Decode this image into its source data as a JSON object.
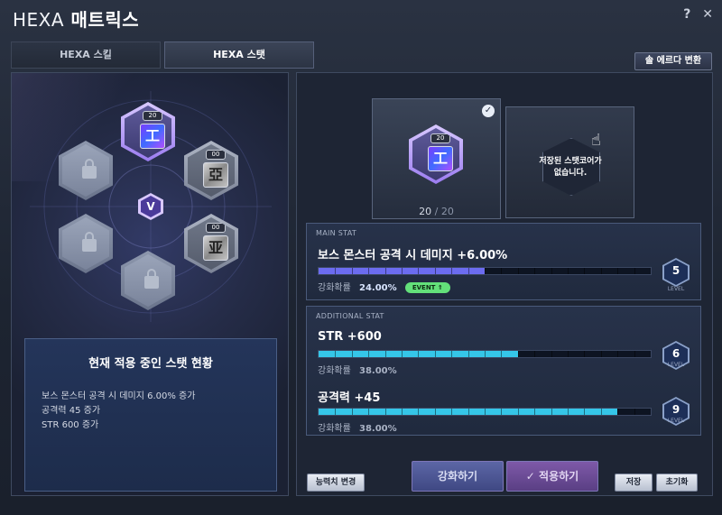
{
  "window": {
    "title_prefix": "HEXA",
    "title_main": "매트릭스",
    "help_icon": "?",
    "close_icon": "✕"
  },
  "tabs": [
    {
      "label": "HEXA 스킬"
    },
    {
      "label": "HEXA 스탯"
    }
  ],
  "sol_erda_button": "솔 에르다 변환",
  "matrix": {
    "top_core": {
      "level": "20",
      "glyph": "工"
    },
    "right_top_core": {
      "level": "00",
      "glyph": "亞"
    },
    "right_bottom_core": {
      "level": "00",
      "glyph": "亚"
    },
    "center_logo": "V"
  },
  "status": {
    "title": "현재 적용 중인 스탯 현황",
    "lines": [
      "보스 몬스터 공격 시 데미지 6.00% 증가",
      "공격력 45 증가",
      "STR 600 증가"
    ]
  },
  "core": {
    "level": "20",
    "glyph": "工",
    "count_current": "20",
    "count_sep": "/",
    "count_max": "20"
  },
  "saved_core": {
    "line1": "저장된 스탯코어가",
    "line2": "없습니다."
  },
  "main_stat": {
    "header": "MAIN STAT",
    "name": "보스 몬스터 공격 시 데미지 +6.00%",
    "rate_label": "강화확률",
    "rate_value": "24.00%",
    "event_label": "EVENT ⇑",
    "level": "5",
    "level_word": "LEVEL",
    "progress": 0.5
  },
  "additional_stat": {
    "header": "ADDITIONAL STAT",
    "items": [
      {
        "name": "STR +600",
        "rate_label": "강화확률",
        "rate_value": "38.00%",
        "level": "6",
        "level_word": "LEVEL",
        "progress": 0.6
      },
      {
        "name": "공격력 +45",
        "rate_label": "강화확률",
        "rate_value": "38.00%",
        "level": "9",
        "level_word": "LEVEL",
        "progress": 0.9
      }
    ]
  },
  "buttons": {
    "change": "능력치 변경",
    "enhance": "강화하기",
    "apply": "적용하기",
    "save": "저장",
    "reset": "초기화"
  },
  "colors": {
    "main_bar": "#6c6cf0",
    "additional_bar": "#35c6e8",
    "event_badge": "#63e07a"
  }
}
